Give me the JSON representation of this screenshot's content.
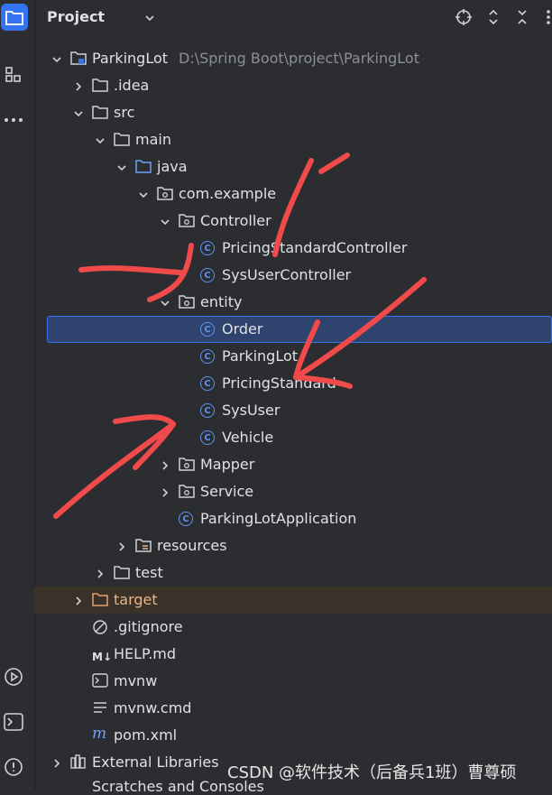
{
  "header": {
    "title": "Project"
  },
  "tree": [
    {
      "indent": 0,
      "arrow": "down",
      "icon": "module",
      "label": "ParkingLot",
      "hint": "D:\\Spring Boot\\project\\ParkingLot"
    },
    {
      "indent": 1,
      "arrow": "right",
      "icon": "folder",
      "label": ".idea"
    },
    {
      "indent": 1,
      "arrow": "down",
      "icon": "folder",
      "label": "src"
    },
    {
      "indent": 2,
      "arrow": "down",
      "icon": "folder",
      "label": "main"
    },
    {
      "indent": 3,
      "arrow": "down",
      "icon": "folder-blue",
      "label": "java"
    },
    {
      "indent": 4,
      "arrow": "down",
      "icon": "package",
      "label": "com.example"
    },
    {
      "indent": 5,
      "arrow": "down",
      "icon": "package",
      "label": "Controller"
    },
    {
      "indent": 6,
      "arrow": "",
      "icon": "class",
      "label": "PricingStandardController"
    },
    {
      "indent": 6,
      "arrow": "",
      "icon": "class",
      "label": "SysUserController"
    },
    {
      "indent": 5,
      "arrow": "down",
      "icon": "package",
      "label": "entity"
    },
    {
      "indent": 6,
      "arrow": "",
      "icon": "class",
      "label": "Order",
      "selected": true
    },
    {
      "indent": 6,
      "arrow": "",
      "icon": "class",
      "label": "ParkingLot"
    },
    {
      "indent": 6,
      "arrow": "",
      "icon": "class",
      "label": "PricingStandard"
    },
    {
      "indent": 6,
      "arrow": "",
      "icon": "class",
      "label": "SysUser"
    },
    {
      "indent": 6,
      "arrow": "",
      "icon": "class",
      "label": "Vehicle"
    },
    {
      "indent": 5,
      "arrow": "right",
      "icon": "package",
      "label": "Mapper"
    },
    {
      "indent": 5,
      "arrow": "right",
      "icon": "package",
      "label": "Service"
    },
    {
      "indent": 5,
      "arrow": "",
      "icon": "class",
      "label": "ParkingLotApplication"
    },
    {
      "indent": 3,
      "arrow": "right",
      "icon": "resources",
      "label": "resources"
    },
    {
      "indent": 2,
      "arrow": "right",
      "icon": "folder",
      "label": "test"
    },
    {
      "indent": 1,
      "arrow": "right",
      "icon": "folder-orange",
      "label": "target",
      "target": true
    },
    {
      "indent": 1,
      "arrow": "",
      "icon": "ignore",
      "label": ".gitignore"
    },
    {
      "indent": 1,
      "arrow": "",
      "icon": "markdown",
      "label": "HELP.md"
    },
    {
      "indent": 1,
      "arrow": "",
      "icon": "terminal",
      "label": "mvnw"
    },
    {
      "indent": 1,
      "arrow": "",
      "icon": "text",
      "label": "mvnw.cmd"
    },
    {
      "indent": 1,
      "arrow": "",
      "icon": "maven",
      "label": "pom.xml"
    },
    {
      "indent": 0,
      "arrow": "right",
      "icon": "library",
      "label": "External Libraries"
    }
  ],
  "scratch_label": "Scratches and Consoles",
  "markdown_badge": "M↓",
  "maven_badge": "m",
  "class_badge": "C",
  "watermark": "CSDN @软件技术（后备兵1班）曹尊硕",
  "colors": {
    "selection": "#2e436e",
    "accent": "#3574f0",
    "annotation": "#f04a4a"
  }
}
